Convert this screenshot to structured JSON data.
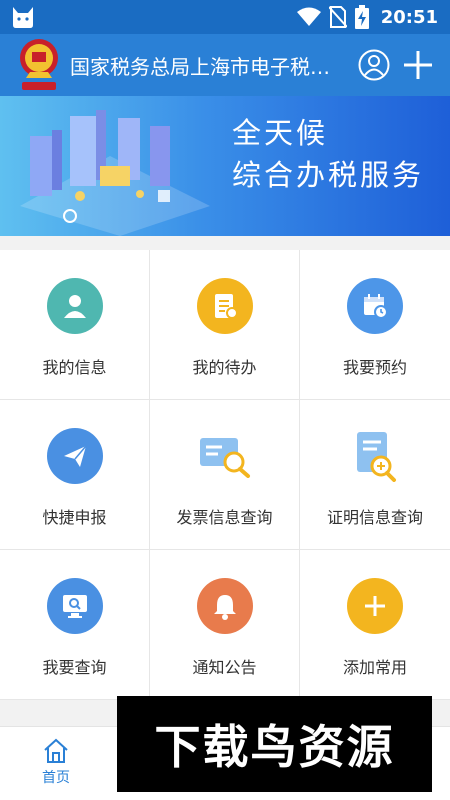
{
  "status_bar": {
    "time": "20:51"
  },
  "app_bar": {
    "title": "国家税务总局上海市电子税…"
  },
  "banner": {
    "line1": "全天候",
    "line2": "综合办税服务"
  },
  "grid": [
    {
      "label": "我的信息",
      "icon": "person-icon",
      "color": "#4fb7b0"
    },
    {
      "label": "我的待办",
      "icon": "todo-document-icon",
      "color": "#f3b51f"
    },
    {
      "label": "我要预约",
      "icon": "calendar-clock-icon",
      "color": "#4d96e8"
    },
    {
      "label": "快捷申报",
      "icon": "paper-plane-icon",
      "color": "#4a90e2"
    },
    {
      "label": "发票信息查询",
      "icon": "invoice-search-icon",
      "color": "#4a90e2"
    },
    {
      "label": "证明信息查询",
      "icon": "certificate-search-icon",
      "color": "#4a90e2"
    },
    {
      "label": "我要查询",
      "icon": "monitor-search-icon",
      "color": "#4a90e2"
    },
    {
      "label": "通知公告",
      "icon": "bell-icon",
      "color": "#e87b4c"
    },
    {
      "label": "添加常用",
      "icon": "add-icon",
      "color": "#f3b51f"
    }
  ],
  "tab_bar": {
    "home_label": "首页"
  },
  "watermark": {
    "text": "下载鸟资源"
  }
}
